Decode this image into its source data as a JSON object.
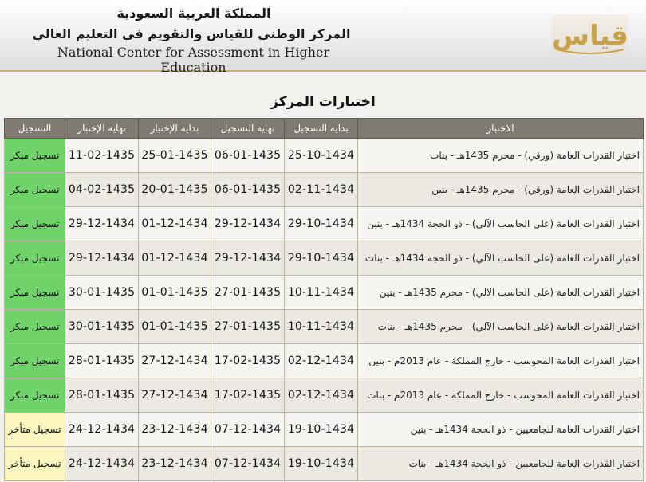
{
  "header": {
    "line1": "المملكة العربية السعودية",
    "line2": "المركز الوطني للقياس والتقويم في التعليم العالي",
    "line3": "National Center for Assessment in Higher Education",
    "logo_text": "قياس"
  },
  "page_title": "اختبارات المركز",
  "columns": [
    "الاختبار",
    "بداية التسجيل",
    "نهاية التسجيل",
    "بداية الإختبار",
    "نهاية الإختبار",
    "التسجيل"
  ],
  "colors": {
    "early": "#6fd36a",
    "late": "#fbf6c0",
    "header_bg": "#7f7b71",
    "accent": "#c9b27a"
  },
  "rows": [
    {
      "name": "اختبار القدرات العامة (ورقي) - محرم 1435هـ - بنات",
      "reg_start": "25-10-1434",
      "reg_end": "06-01-1435",
      "test_start": "25-01-1435",
      "test_end": "11-02-1435",
      "status": "تسجيل مبكر",
      "status_type": "early"
    },
    {
      "name": "اختبار القدرات العامة (ورقي) - محرم 1435هـ - بنين",
      "reg_start": "02-11-1434",
      "reg_end": "06-01-1435",
      "test_start": "20-01-1435",
      "test_end": "04-02-1435",
      "status": "تسجيل مبكر",
      "status_type": "early"
    },
    {
      "name": "اختبار القدرات العامة (على الحاسب الآلي) - ذو الحجة 1434هـ - بنين",
      "reg_start": "29-10-1434",
      "reg_end": "29-12-1434",
      "test_start": "01-12-1434",
      "test_end": "29-12-1434",
      "status": "تسجيل مبكر",
      "status_type": "early"
    },
    {
      "name": "اختبار القدرات العامة (على الحاسب الآلي) - ذو الحجة 1434هـ - بنات",
      "reg_start": "29-10-1434",
      "reg_end": "29-12-1434",
      "test_start": "01-12-1434",
      "test_end": "29-12-1434",
      "status": "تسجيل مبكر",
      "status_type": "early"
    },
    {
      "name": "اختبار القدرات العامة (على الحاسب الآلي) - محرم 1435هـ - بنين",
      "reg_start": "10-11-1434",
      "reg_end": "27-01-1435",
      "test_start": "01-01-1435",
      "test_end": "30-01-1435",
      "status": "تسجيل مبكر",
      "status_type": "early"
    },
    {
      "name": "اختبار القدرات العامة (على الحاسب الآلي) - محرم 1435هـ - بنات",
      "reg_start": "10-11-1434",
      "reg_end": "27-01-1435",
      "test_start": "01-01-1435",
      "test_end": "30-01-1435",
      "status": "تسجيل مبكر",
      "status_type": "early"
    },
    {
      "name": "اختبار القدرات العامة المحوسب - خارج المملكة - عام 2013م - بنين",
      "reg_start": "02-12-1434",
      "reg_end": "17-02-1435",
      "test_start": "27-12-1434",
      "test_end": "28-01-1435",
      "status": "تسجيل مبكر",
      "status_type": "early"
    },
    {
      "name": "اختبار القدرات العامة المحوسب - خارج المملكة - عام 2013م - بنات",
      "reg_start": "02-12-1434",
      "reg_end": "17-02-1435",
      "test_start": "27-12-1434",
      "test_end": "28-01-1435",
      "status": "تسجيل مبكر",
      "status_type": "early"
    },
    {
      "name": "اختبار القدرات العامة للجامعيين - ذو الحجة 1434هـ - بنين",
      "reg_start": "19-10-1434",
      "reg_end": "07-12-1434",
      "test_start": "23-12-1434",
      "test_end": "24-12-1434",
      "status": "تسجيل متأخر",
      "status_type": "late"
    },
    {
      "name": "اختبار القدرات العامة للجامعيين - ذو الحجة 1434هـ - بنات",
      "reg_start": "19-10-1434",
      "reg_end": "07-12-1434",
      "test_start": "23-12-1434",
      "test_end": "24-12-1434",
      "status": "تسجيل متأخر",
      "status_type": "late"
    }
  ]
}
